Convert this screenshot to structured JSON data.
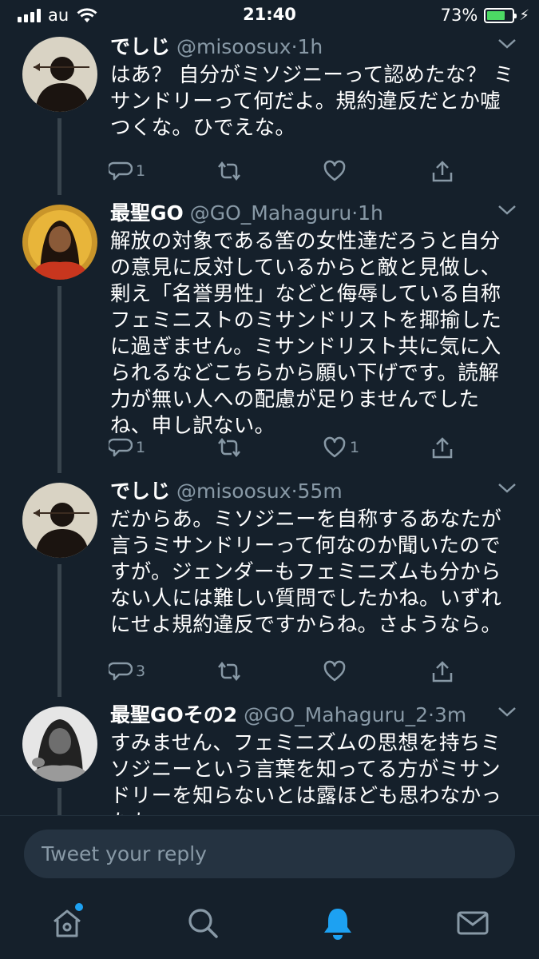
{
  "status_bar": {
    "carrier": "au",
    "time": "21:40",
    "battery_percent": "73%",
    "battery_level": 0.73
  },
  "tweets": [
    {
      "name": "でしじ",
      "handle": "@misoosux",
      "time": "1h",
      "text": "はあ？ 自分がミソジニーって認めたな？ ミサンドリーって何だよ。規約違反だとか嘘つくな。ひでえな。",
      "reply_count": "1",
      "retweet_count": "",
      "like_count": ""
    },
    {
      "name": "最聖GO",
      "handle": "@GO_Mahaguru",
      "time": "1h",
      "text": "解放の対象である筈の女性達だろうと自分の意見に反対しているからと敵と見做し、剰え「名誉男性」などと侮辱している自称フェミニストのミサンドリストを揶揄したに過ぎません。ミサンドリスト共に気に入られるなどこちらから願い下げです。読解力が無い人への配慮が足りませんでしたね、申し訳ない。",
      "reply_count": "1",
      "retweet_count": "",
      "like_count": "1"
    },
    {
      "name": "でしじ",
      "handle": "@misoosux",
      "time": "55m",
      "text": "だからあ。ミソジニーを自称するあなたが言うミサンドリーって何なのか聞いたのですが。ジェンダーもフェミニズムも分からない人には難しい質問でしたかね。いずれにせよ規約違反ですからね。さようなら。",
      "reply_count": "3",
      "retweet_count": "",
      "like_count": ""
    },
    {
      "name": "最聖GOその2",
      "handle": "@GO_Mahaguru_2",
      "time": "3m",
      "text": "すみません、フェミニズムの思想を持ちミソジニーという言葉を知ってる方がミサンドリーを知らないとは露ほども思わなかったも"
    }
  ],
  "reply_input": {
    "placeholder": "Tweet your reply",
    "value": ""
  },
  "tab_bar": {
    "items": [
      "home-icon",
      "search-icon",
      "notifications-icon",
      "messages-icon"
    ],
    "active": "notifications-icon",
    "active_color": "#1da1f2",
    "home_has_new": true
  },
  "colors": {
    "background": "#15202b",
    "secondary_text": "#8899a6",
    "accent": "#1da1f2",
    "battery": "#4cd964"
  }
}
